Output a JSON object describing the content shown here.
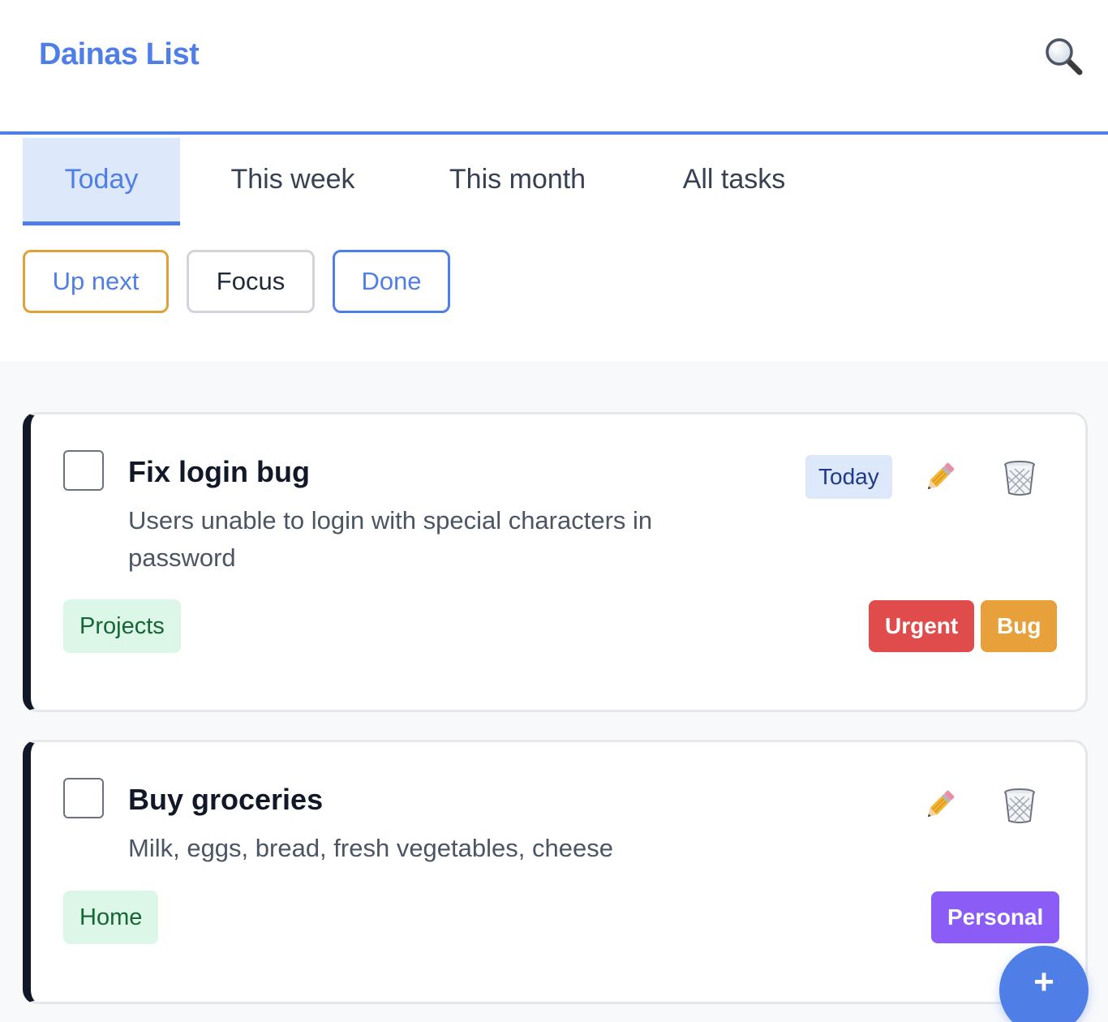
{
  "app": {
    "title": "Dainas List"
  },
  "tabs": [
    {
      "label": "Today",
      "active": true
    },
    {
      "label": "This week",
      "active": false
    },
    {
      "label": "This month",
      "active": false
    },
    {
      "label": "All tasks",
      "active": false
    }
  ],
  "filters": [
    {
      "label": "Up next",
      "border_color": "#e0a13a"
    },
    {
      "label": "Focus",
      "border_color": "#d1d5db"
    },
    {
      "label": "Done",
      "border_color": "#4f7fe6"
    }
  ],
  "tasks": [
    {
      "title": "Fix login bug",
      "description": "Users unable to login with special characters in password",
      "due": "Today",
      "category": "Projects",
      "tags": [
        {
          "label": "Urgent",
          "color": "#e04b4b"
        },
        {
          "label": "Bug",
          "color": "#e8a03a"
        }
      ],
      "completed": false
    },
    {
      "title": "Buy groceries",
      "description": "Milk, eggs, bread, fresh vegetables, cheese",
      "due": "",
      "category": "Home",
      "tags": [
        {
          "label": "Personal",
          "color": "#8b5cf6"
        }
      ],
      "completed": false
    }
  ],
  "fab": {
    "label": "+"
  },
  "colors": {
    "accent": "#4f7fe6",
    "card_accent": "#111827"
  },
  "icons": {
    "search": "magnifier-icon",
    "edit": "pencil-icon",
    "delete": "trash-icon"
  }
}
